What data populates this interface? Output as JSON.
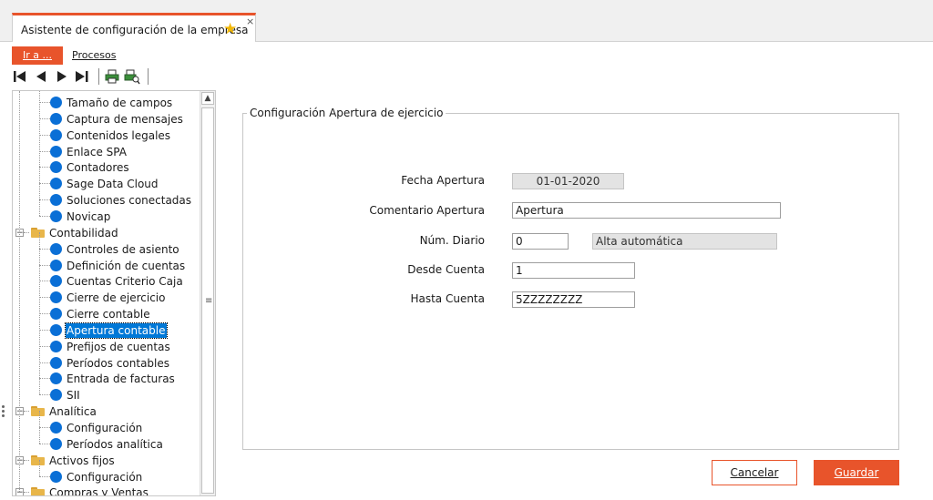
{
  "tab": {
    "title": "Asistente de configuración de la empresa",
    "star_icon": "star-icon",
    "close_glyph": "×"
  },
  "menu": {
    "ira": "Ir a ...",
    "procesos": "Procesos"
  },
  "toolbar": {
    "buttons": [
      "first-record-icon",
      "previous-record-icon",
      "next-record-icon",
      "last-record-icon",
      "print-icon",
      "print-preview-icon"
    ]
  },
  "tree": {
    "nodes": [
      {
        "label": "Tamaño de campos",
        "level": 2,
        "type": "leaf"
      },
      {
        "label": "Captura de mensajes",
        "level": 2,
        "type": "leaf"
      },
      {
        "label": "Contenidos legales",
        "level": 2,
        "type": "leaf"
      },
      {
        "label": "Enlace SPA",
        "level": 2,
        "type": "leaf"
      },
      {
        "label": "Contadores",
        "level": 2,
        "type": "leaf"
      },
      {
        "label": "Sage Data Cloud",
        "level": 2,
        "type": "leaf"
      },
      {
        "label": "Soluciones conectadas",
        "level": 2,
        "type": "leaf"
      },
      {
        "label": "Novicap",
        "level": 2,
        "type": "leaf"
      },
      {
        "label": "Contabilidad",
        "level": 1,
        "type": "folder",
        "expanded": true
      },
      {
        "label": "Controles de asiento",
        "level": 2,
        "type": "leaf"
      },
      {
        "label": "Definición de cuentas",
        "level": 2,
        "type": "leaf"
      },
      {
        "label": "Cuentas Criterio Caja",
        "level": 2,
        "type": "leaf"
      },
      {
        "label": "Cierre de ejercicio",
        "level": 2,
        "type": "leaf"
      },
      {
        "label": "Cierre contable",
        "level": 2,
        "type": "leaf"
      },
      {
        "label": "Apertura contable",
        "level": 2,
        "type": "leaf",
        "selected": true
      },
      {
        "label": "Prefijos de cuentas",
        "level": 2,
        "type": "leaf"
      },
      {
        "label": "Períodos contables",
        "level": 2,
        "type": "leaf"
      },
      {
        "label": "Entrada de facturas",
        "level": 2,
        "type": "leaf"
      },
      {
        "label": "SII",
        "level": 2,
        "type": "leaf"
      },
      {
        "label": "Analítica",
        "level": 1,
        "type": "folder",
        "expanded": true
      },
      {
        "label": "Configuración",
        "level": 2,
        "type": "leaf"
      },
      {
        "label": "Períodos analítica",
        "level": 2,
        "type": "leaf"
      },
      {
        "label": "Activos fijos",
        "level": 1,
        "type": "folder",
        "expanded": true
      },
      {
        "label": "Configuración",
        "level": 2,
        "type": "leaf"
      },
      {
        "label": "Compras y Ventas",
        "level": 1,
        "type": "folder",
        "expanded": true
      }
    ]
  },
  "form": {
    "group_title": "Configuración Apertura de ejercicio",
    "fecha_apertura": {
      "label": "Fecha Apertura",
      "value": "01-01-2020"
    },
    "comentario_apertura": {
      "label": "Comentario Apertura",
      "value": "Apertura"
    },
    "num_diario": {
      "label": "Núm. Diario",
      "value": "0",
      "description": "Alta automática"
    },
    "desde_cuenta": {
      "label": "Desde Cuenta",
      "value": "1"
    },
    "hasta_cuenta": {
      "label": "Hasta Cuenta",
      "value": "5ZZZZZZZZ"
    }
  },
  "buttons": {
    "cancel": "Cancelar",
    "save": "Guardar"
  },
  "colors": {
    "accent": "#e8542b",
    "node_dot": "#0a6fd6",
    "selection": "#0078d7",
    "folder": "#e8b64a"
  }
}
